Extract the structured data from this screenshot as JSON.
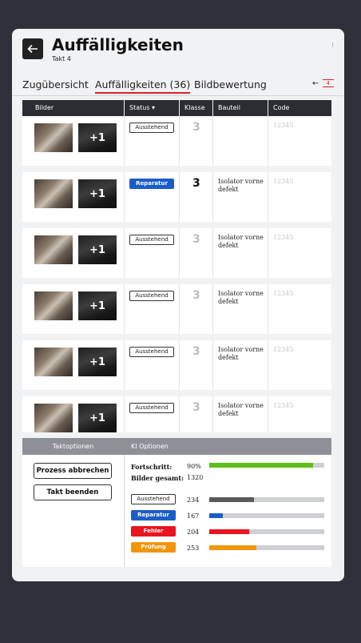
{
  "header": {
    "title": "Auffälligkeiten",
    "subtitle": "Takt 4",
    "back_icon": "arrow-left-icon"
  },
  "tabs": [
    {
      "label": "Zugübersicht",
      "active": false
    },
    {
      "label": "Auffälligkeiten (36)",
      "active": true
    },
    {
      "label": "Bildbewertung",
      "active": false
    }
  ],
  "tab_nav": {
    "arrow": "←",
    "number": "4"
  },
  "table": {
    "columns": [
      "Bilder",
      "Status ▾",
      "Klasse",
      "Bauteil",
      "Code"
    ],
    "rows": [
      {
        "extra_images": "+1",
        "status": "Ausstehend",
        "status_type": "pending",
        "klasse": "3",
        "bauteil": "",
        "code": "12345"
      },
      {
        "extra_images": "+1",
        "status": "Reparatur",
        "status_type": "repair",
        "klasse": "3",
        "bauteil": "Isolator vorne defekt",
        "code": "12345"
      },
      {
        "extra_images": "+1",
        "status": "Ausstehend",
        "status_type": "pending",
        "klasse": "3",
        "bauteil": "Isolator vorne defekt",
        "code": "12345"
      },
      {
        "extra_images": "+1",
        "status": "Ausstehend",
        "status_type": "pending",
        "klasse": "3",
        "bauteil": "Isolator vorne defekt",
        "code": "12345"
      },
      {
        "extra_images": "+1",
        "status": "Ausstehend",
        "status_type": "pending",
        "klasse": "3",
        "bauteil": "Isolator vorne defekt",
        "code": "12345"
      },
      {
        "extra_images": "+1",
        "status": "Ausstehend",
        "status_type": "pending",
        "klasse": "3",
        "bauteil": "Isolator vorne defekt",
        "code": "12345"
      }
    ]
  },
  "takt_options": {
    "header": "Taktoptionen",
    "buttons": [
      "Prozess abbrechen",
      "Takt beenden"
    ]
  },
  "ki_options": {
    "header": "KI Optionen",
    "progress_label": "Fortschritt:",
    "progress_value": "90%",
    "progress_fraction": 0.9,
    "progress_color": "#5cbf1a",
    "images_label": "Bilder gesamt:",
    "images_value": "1320",
    "categories": [
      {
        "label": "Ausstehend",
        "count": "234",
        "fraction": 0.39,
        "color": "#5a5a5a",
        "style": "outline"
      },
      {
        "label": "Reparatur",
        "count": "167",
        "fraction": 0.12,
        "color": "#1a5dc9",
        "style": "filled"
      },
      {
        "label": "Fehler",
        "count": "204",
        "fraction": 0.35,
        "color": "#e8141e",
        "style": "filled"
      },
      {
        "label": "Prüfung",
        "count": "253",
        "fraction": 0.41,
        "color": "#f0950c",
        "style": "filled"
      }
    ]
  }
}
